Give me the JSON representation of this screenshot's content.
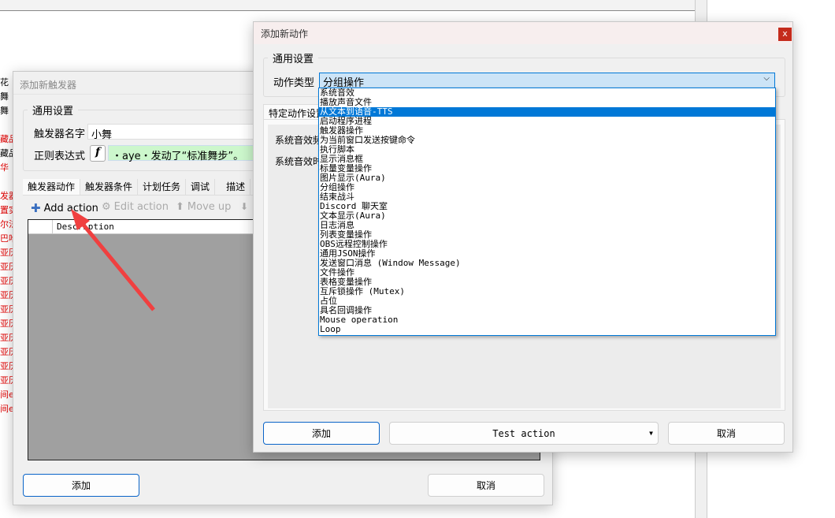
{
  "background": {
    "left_fragments": [
      {
        "text": "花",
        "color": "#000000"
      },
      {
        "text": "舞",
        "color": "#000000"
      },
      {
        "text": "舞",
        "color": "#000000"
      },
      {
        "text": "",
        "color": "#000000"
      },
      {
        "text": "藏品",
        "color": "#e00000"
      },
      {
        "text": "藏品",
        "color": "#000000"
      },
      {
        "text": "华",
        "color": "#e00000"
      },
      {
        "text": "",
        "color": "#000000"
      },
      {
        "text": "发器剂",
        "color": "#e00000"
      },
      {
        "text": "置实",
        "color": "#e00000"
      },
      {
        "text": "尔法",
        "color": "#e00000"
      },
      {
        "text": "巴哈",
        "color": "#e00000"
      },
      {
        "text": "亚历",
        "color": "#e00000"
      },
      {
        "text": "亚历",
        "color": "#e00000"
      },
      {
        "text": "亚历",
        "color": "#e00000"
      },
      {
        "text": "亚历",
        "color": "#e00000"
      },
      {
        "text": "亚历",
        "color": "#e00000"
      },
      {
        "text": "亚历",
        "color": "#e00000"
      },
      {
        "text": "亚历",
        "color": "#e00000"
      },
      {
        "text": "亚历",
        "color": "#e00000"
      },
      {
        "text": "亚历",
        "color": "#e00000"
      },
      {
        "text": "亚历",
        "color": "#e00000"
      },
      {
        "text": "间e1",
        "color": "#e00000"
      },
      {
        "text": "间e5",
        "color": "#e00000"
      }
    ]
  },
  "trigger_dialog": {
    "title": "添加新触发器",
    "general_group": "通用设置",
    "name_label": "触发器名字",
    "name_value": "小舞",
    "regex_label": "正则表达式",
    "regex_value": "・aye・发动了“标准舞步”。",
    "tabs": [
      "触发器动作",
      "触发器条件",
      "计划任务",
      "调试",
      "描述"
    ],
    "toolbar": {
      "add": "Add action",
      "edit": "Edit action",
      "move_up": "Move up"
    },
    "list_header": "Description",
    "ok": "添加",
    "cancel": "取消"
  },
  "action_dialog": {
    "title": "添加新动作",
    "close": "x",
    "general_group": "通用设置",
    "type_label": "动作类型",
    "type_value": "分组操作",
    "options": [
      "系统音效",
      "播放声音文件",
      "从文本到语音-TTS",
      "启动程序进程",
      "触发器操作",
      "为当前窗口发送按键命令",
      "执行脚本",
      "显示消息框",
      "标量变量操作",
      "图片显示(Aura)",
      "分组操作",
      "结束战斗",
      "Discord 聊天室",
      "文本显示(Aura)",
      "日志消息",
      "列表变量操作",
      "OBS远程控制操作",
      "通用JSON操作",
      "发送窗口消息 (Window Message)",
      "文件操作",
      "表格变量操作",
      "互斥锁操作 (Mutex)",
      "占位",
      "具名回调操作",
      "Mouse operation",
      "Loop"
    ],
    "highlighted_option": "从文本到语音-TTS",
    "specific_tab": "特定动作设置",
    "field1": "系统音效频",
    "field2": "系统音效时",
    "ok": "添加",
    "test": "Test action",
    "cancel": "取消"
  },
  "colors": {
    "highlight": "#0078d7",
    "regex_bg": "#ccf7cc",
    "arrow": "#f04040",
    "close": "#c42b1c"
  }
}
